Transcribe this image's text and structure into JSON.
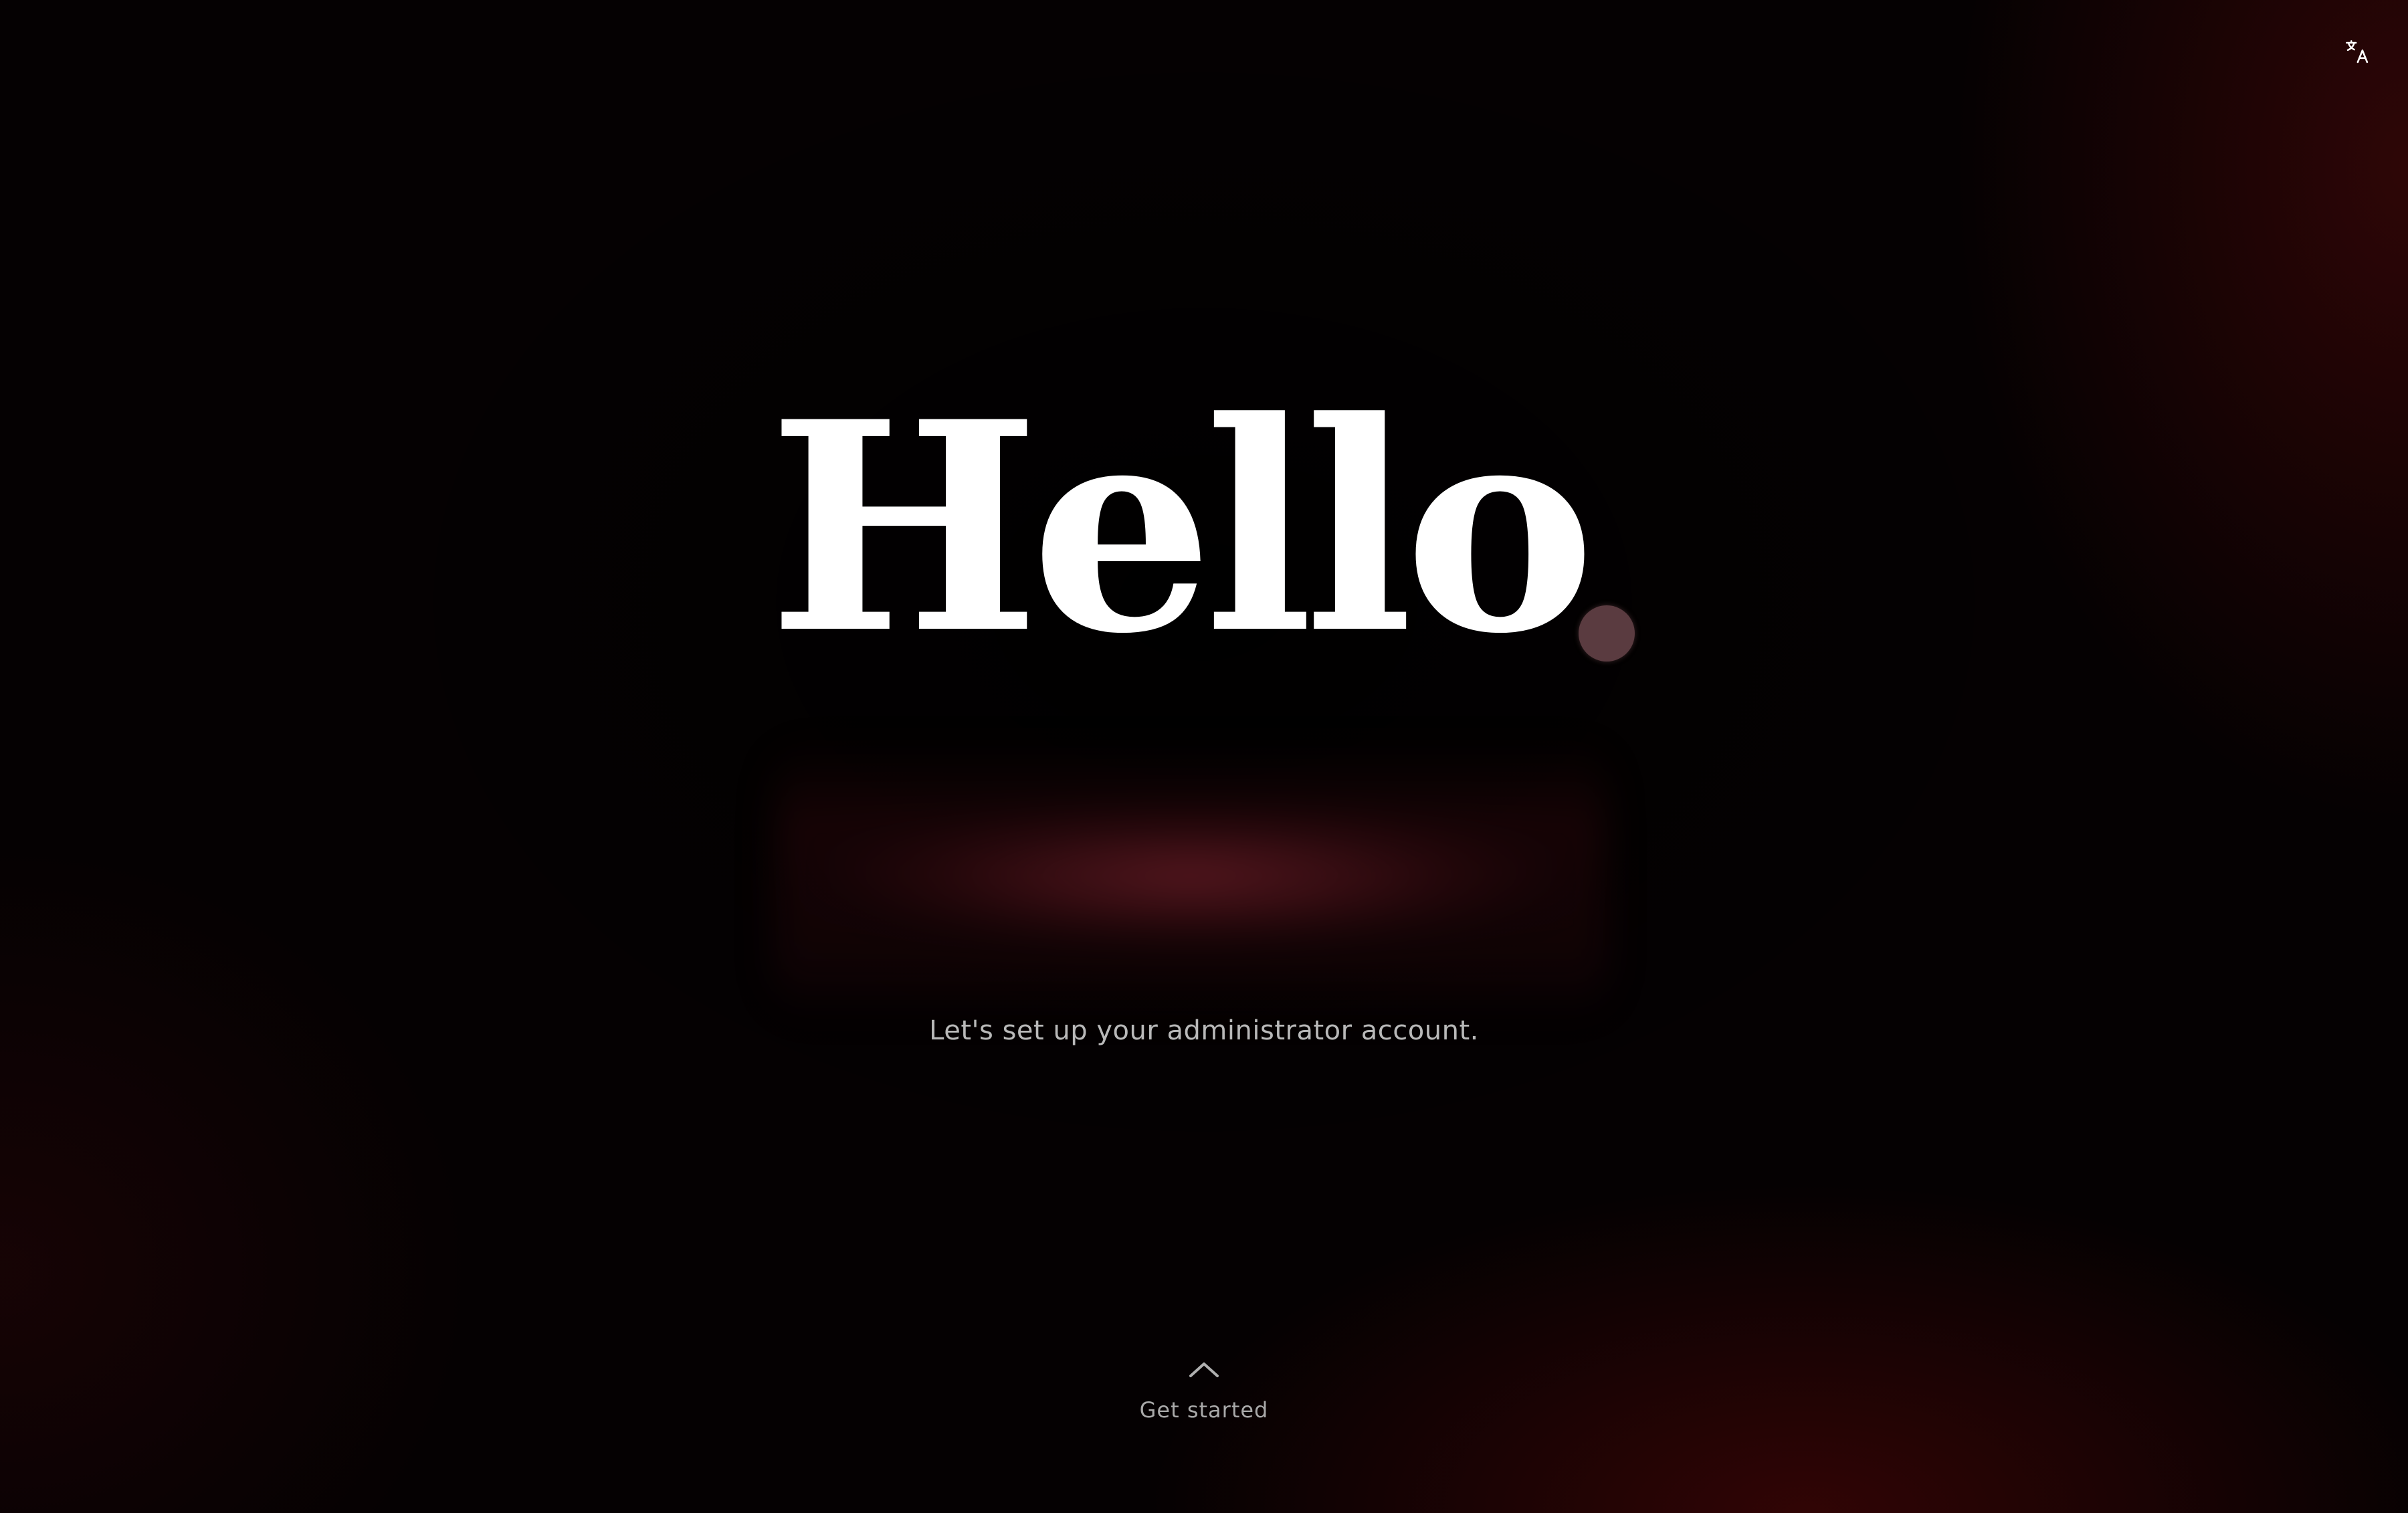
{
  "header": {
    "language_icon": "translate-icon"
  },
  "hero": {
    "greeting": "Hello",
    "subtitle": "Let's set up your administrator account."
  },
  "footer": {
    "chevron_icon": "chevron-up-icon",
    "get_started_label": "Get started"
  },
  "colors": {
    "background": "#000000",
    "accent_glow": "#5a0b0b",
    "dot": "#5a3b40",
    "text_primary": "#ffffff",
    "text_secondary": "#b9b9b9"
  }
}
